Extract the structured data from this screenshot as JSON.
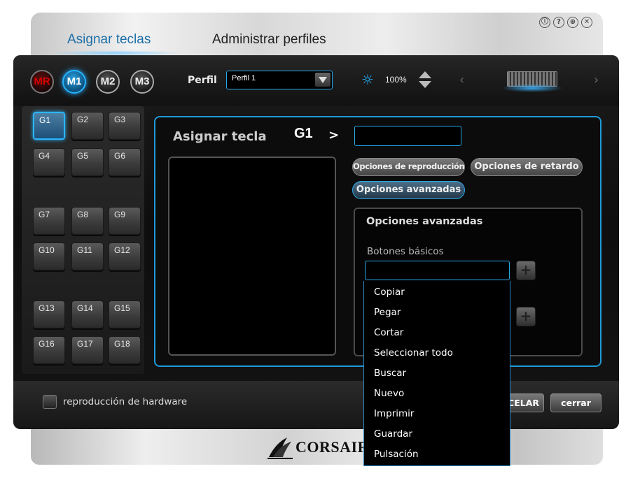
{
  "window": {
    "controls": [
      "ⓘ",
      "?",
      "⊕",
      "✕"
    ]
  },
  "top_tabs": [
    {
      "label": "Asignar teclas",
      "active": true
    },
    {
      "label": "Administrar perfiles",
      "active": false
    }
  ],
  "modes": [
    "MR",
    "M1",
    "M2",
    "M3"
  ],
  "active_mode": "M1",
  "profile": {
    "label": "Perfil",
    "value": "Perfil 1"
  },
  "brightness": "100%",
  "gkeys": [
    "G1",
    "G2",
    "G3",
    "G4",
    "G5",
    "G6",
    "G7",
    "G8",
    "G9",
    "G10",
    "G11",
    "G12",
    "G13",
    "G14",
    "G15",
    "G16",
    "G17",
    "G18"
  ],
  "active_gkey": "G1",
  "assign": {
    "title": "Asignar tecla",
    "key": "G1",
    "chevron": ">",
    "input_value": ""
  },
  "options": {
    "playback": "Opciones de reproducción",
    "delay": "Opciones de retardo",
    "advanced": "Opciones avanzadas"
  },
  "advanced_panel": {
    "title": "Opciones avanzadas",
    "basic_buttons_label": "Botones básicos",
    "add_symbol": "+"
  },
  "dropdown_items": [
    "Copiar",
    "Pegar",
    "Cortar",
    "Seleccionar todo",
    "Buscar",
    "Nuevo",
    "Imprimir",
    "Guardar",
    "Pulsación"
  ],
  "bottom": {
    "hardware_playback_label": "reproducción de hardware",
    "cancel_label": "CELAR",
    "close_label": "cerrar"
  },
  "brand": {
    "logo_text": "CORSAIR"
  },
  "colors": {
    "accent": "#26a8e8",
    "active_tab_text": "#1d6fa8",
    "macro_record": "#d40000"
  }
}
